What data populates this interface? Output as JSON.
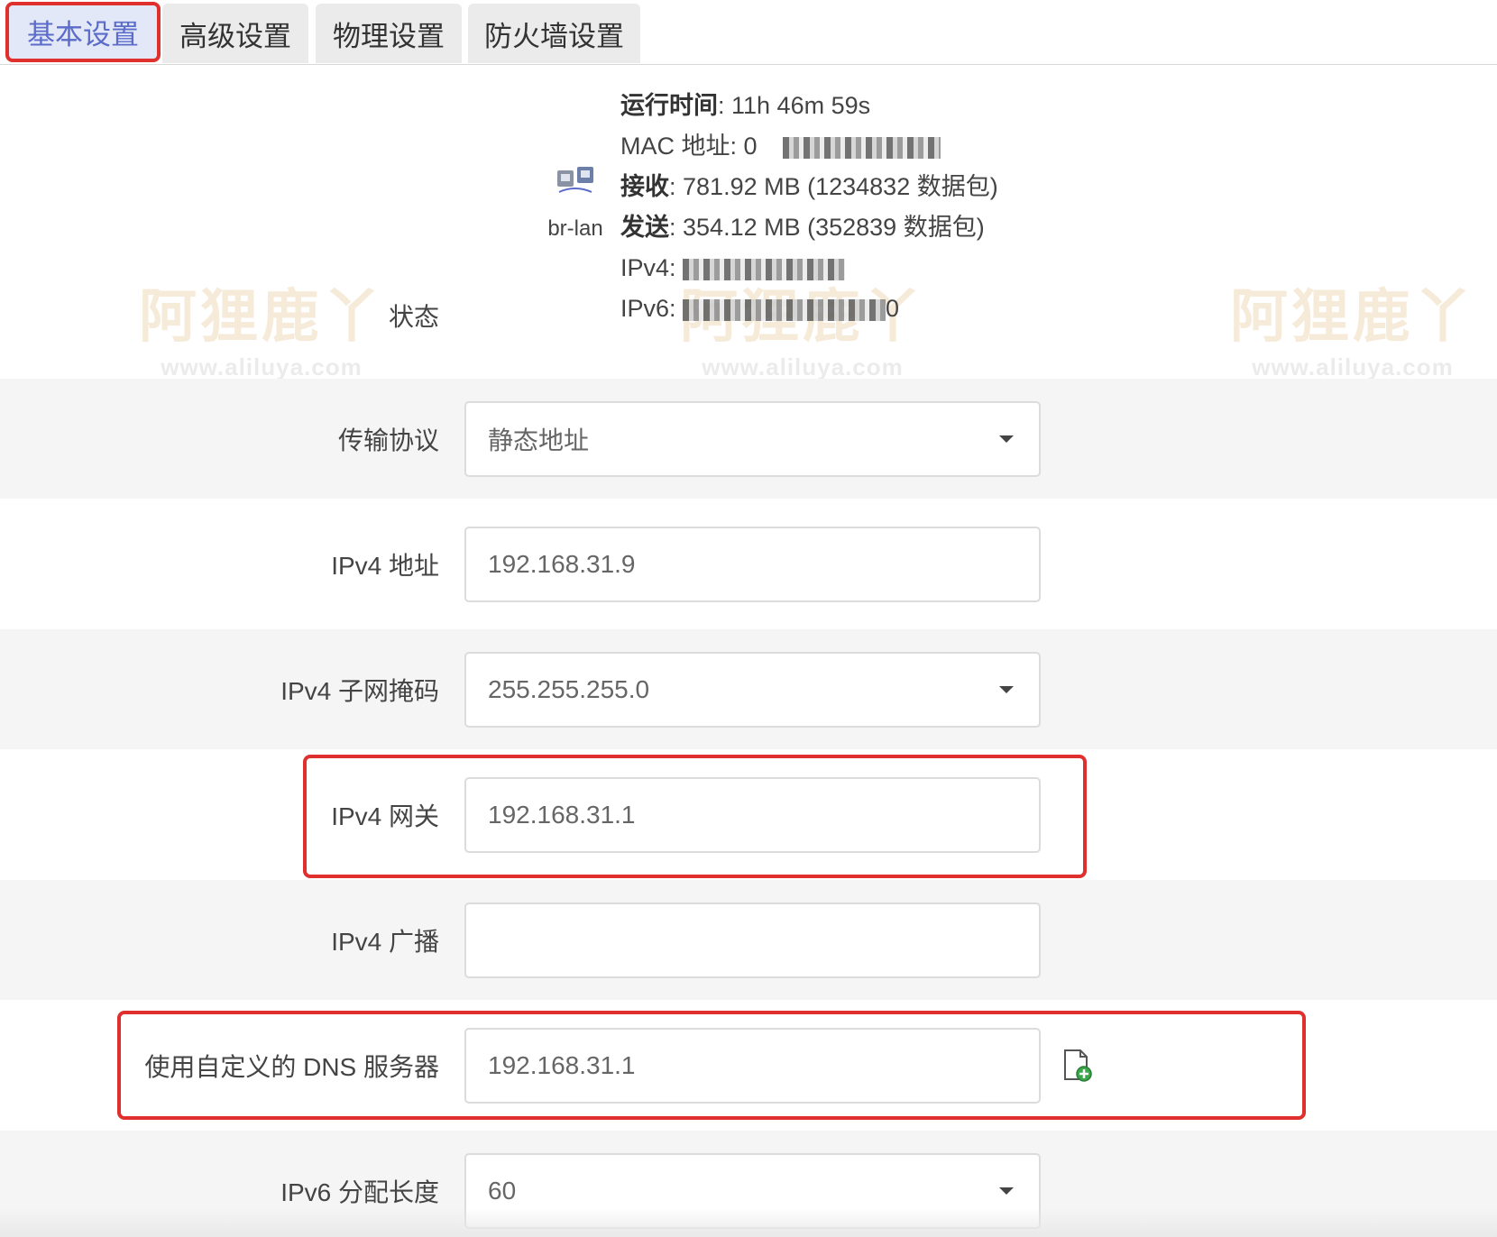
{
  "tabs": [
    {
      "label": "基本设置",
      "active": true
    },
    {
      "label": "高级设置",
      "active": false
    },
    {
      "label": "物理设置",
      "active": false
    },
    {
      "label": "防火墙设置",
      "active": false
    }
  ],
  "status": {
    "label": "状态",
    "interface_name": "br-lan",
    "uptime_label": "运行时间",
    "uptime_value": "11h 46m 59s",
    "mac_label": "MAC 地址",
    "mac_prefix": "0",
    "rx_label": "接收",
    "rx_value": "781.92 MB (1234832 数据包)",
    "tx_label": "发送",
    "tx_value": "354.12 MB (352839 数据包)",
    "ipv4_label": "IPv4",
    "ipv6_label": "IPv6",
    "ipv6_suffix": "0"
  },
  "form": {
    "protocol": {
      "label": "传输协议",
      "value": "静态地址"
    },
    "ipv4_addr": {
      "label": "IPv4 地址",
      "value": "192.168.31.9"
    },
    "ipv4_mask": {
      "label": "IPv4 子网掩码",
      "value": "255.255.255.0"
    },
    "ipv4_gateway": {
      "label": "IPv4 网关",
      "value": "192.168.31.1"
    },
    "ipv4_broadcast": {
      "label": "IPv4 广播",
      "value": ""
    },
    "dns": {
      "label": "使用自定义的 DNS 服务器",
      "value": "192.168.31.1"
    },
    "ipv6_assign": {
      "label": "IPv6 分配长度",
      "value": "60"
    }
  },
  "watermark": {
    "title": "阿狸鹿丫",
    "subtitle": "Aliluya",
    "url": "www.aliluya.com"
  },
  "colors": {
    "highlight": "#e0302d",
    "active_tab_text": "#5b6cc9",
    "active_tab_bg": "#e3e8f8"
  }
}
